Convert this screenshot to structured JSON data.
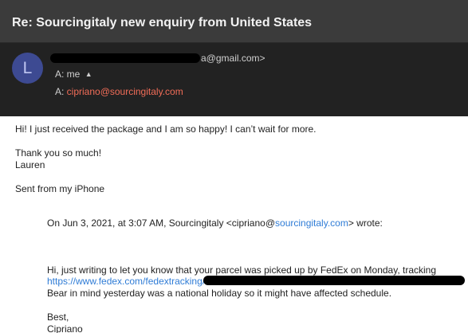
{
  "subject": {
    "title": "Re: Sourcingitaly new enquiry from United States"
  },
  "sender": {
    "avatar_initial": "L",
    "email_suffix": "a@gmail.com>"
  },
  "recipients": {
    "to_prefix": "A: ",
    "to_name": "me",
    "to_caret": "▲",
    "cc_prefix": "A: ",
    "cc_email": "cipriano@sourcingitaly.com"
  },
  "body": {
    "line1": "Hi! I just received the package and I am so happy! I can’t wait for more.",
    "line2": "Thank you so much!",
    "line3": "Lauren",
    "line4": "Sent from my iPhone",
    "quote_header_prefix": "On Jun 3, 2021, at 3:07 AM, Sourcingitaly <cipriano@",
    "quote_header_link": "sourcingitaly.com",
    "quote_header_suffix": "> wrote:",
    "quote_line1": "Hi, just writing to let you know that your parcel was picked up by FedEx on Monday, tracking",
    "quote_link": "https://www.fedex.com/fedextracking/?trknbr",
    "quote_line3": "Bear in mind yesterday was a national holiday so it might have affected schedule.",
    "sign1": "Best,",
    "sign2": "Cipriano"
  },
  "colors": {
    "subject_bg": "#3b3b3b",
    "header_bg": "#222222",
    "avatar_bg": "#3d4a92",
    "link_blue": "#2f7cd6",
    "cc_email_orange": "#f26d58"
  }
}
